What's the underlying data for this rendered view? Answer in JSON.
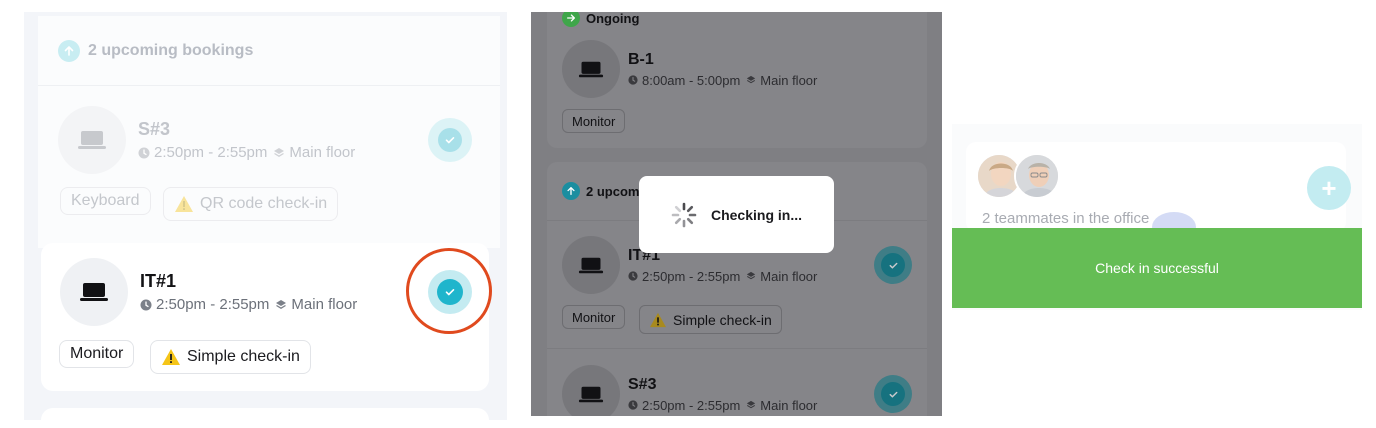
{
  "panel1": {
    "header": {
      "count_label": "2 upcoming bookings"
    },
    "booking1": {
      "name": "S#3",
      "time": "2:50pm - 2:55pm",
      "floor": "Main floor",
      "tags": [
        "Keyboard",
        "QR code check-in"
      ]
    },
    "booking2": {
      "name": "IT#1",
      "time": "2:50pm - 2:55pm",
      "floor": "Main floor",
      "tags": [
        "Monitor",
        "Simple check-in"
      ]
    }
  },
  "panel2": {
    "ongoing_label": "Ongoing",
    "ongoing": {
      "name": "B-1",
      "time": "8:00am - 5:00pm",
      "floor": "Main floor",
      "tag": "Monitor"
    },
    "upcoming_label": "2 upcom",
    "booking1": {
      "name": "IT#1",
      "time": "2:50pm - 2:55pm",
      "floor": "Main floor",
      "tags": [
        "Monitor",
        "Simple check-in"
      ]
    },
    "booking2": {
      "name": "S#3",
      "time": "2:50pm - 2:55pm",
      "floor": "Main floor"
    },
    "modal_text": "Checking in..."
  },
  "panel3": {
    "teammates_text": "2 teammates in the office",
    "add_symbol": "+",
    "toast_text": "Check in successful"
  },
  "icons": [
    "arrow-up-icon",
    "arrow-right-icon",
    "laptop-icon",
    "clock-icon",
    "layers-icon",
    "check-icon",
    "warning-icon",
    "spinner-icon",
    "plus-icon",
    "avatar"
  ],
  "colors": {
    "accent_teal": "#1fb5cc",
    "accent_light": "#c8edf2",
    "ongoing_green": "#3fa64a",
    "highlight_red": "#e04a1e",
    "toast_green": "#65bd55",
    "warning_yellow": "#f5c518"
  }
}
